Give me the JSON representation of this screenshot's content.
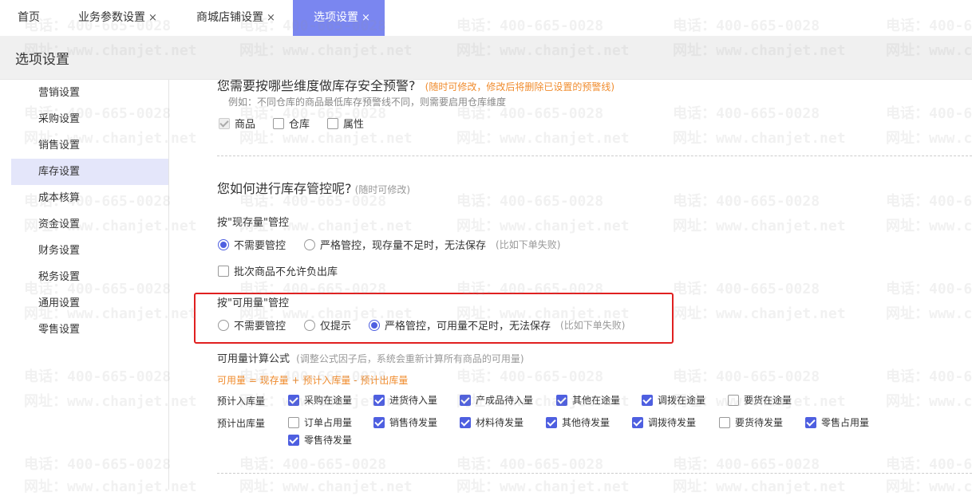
{
  "tabs": [
    {
      "label": "首页",
      "closable": false
    },
    {
      "label": "业务参数设置",
      "close": "×"
    },
    {
      "label": "商城店铺设置",
      "close": "×"
    },
    {
      "label": "选项设置",
      "close": "×",
      "active": true
    }
  ],
  "page_title": "选项设置",
  "sidebar": {
    "items": [
      "营销设置",
      "采购设置",
      "销售设置",
      "库存设置",
      "成本核算",
      "资金设置",
      "财务设置",
      "税务设置",
      "通用设置",
      "零售设置"
    ],
    "active_index": 3
  },
  "section1": {
    "question": "您需要按哪些维度做库存安全预警?",
    "hint": "(随时可修改，修改后将删除已设置的预警线)",
    "example": "例如：不同仓库的商品最低库存预警线不同，则需要启用仓库维度",
    "options": [
      {
        "label": "商品",
        "checked": true,
        "disabled": true
      },
      {
        "label": "仓库",
        "checked": false
      },
      {
        "label": "属性",
        "checked": false
      }
    ]
  },
  "section2": {
    "title": "您如何进行库存管控呢?",
    "title_note": "(随时可修改)",
    "stock": {
      "label": "按\"现存量\"管控",
      "options": [
        {
          "label": "不需要管控",
          "selected": true
        },
        {
          "label": "严格管控，现存量不足时，无法保存",
          "selected": false
        }
      ],
      "note": "(比如下单失败)",
      "batch_label": "批次商品不允许负出库"
    },
    "available": {
      "label": "按\"可用量\"管控",
      "options": [
        {
          "label": "不需要管控",
          "selected": false
        },
        {
          "label": "仅提示",
          "selected": false
        },
        {
          "label": "严格管控，可用量不足时，无法保存",
          "selected": true
        }
      ],
      "note": "(比如下单失败)"
    },
    "formula": {
      "label": "可用量计算公式",
      "note": "(调整公式因子后，系统会重新计算所有商品的可用量)",
      "expression": "可用量 = 现存量 + 预计入库量 - 预计出库量",
      "inbound_label": "预计入库量",
      "inbound": [
        {
          "label": "采购在途量",
          "checked": true
        },
        {
          "label": "进货待入量",
          "checked": true
        },
        {
          "label": "产成品待入量",
          "checked": true
        },
        {
          "label": "其他在途量",
          "checked": true
        },
        {
          "label": "调拨在途量",
          "checked": true
        },
        {
          "label": "要货在途量",
          "checked": false
        }
      ],
      "outbound_label": "预计出库量",
      "outbound": [
        {
          "label": "订单占用量",
          "checked": false
        },
        {
          "label": "销售待发量",
          "checked": true
        },
        {
          "label": "材料待发量",
          "checked": true
        },
        {
          "label": "其他待发量",
          "checked": true
        },
        {
          "label": "调拨待发量",
          "checked": true
        },
        {
          "label": "要货待发量",
          "checked": false
        },
        {
          "label": "零售占用量",
          "checked": true
        },
        {
          "label": "零售待发量",
          "checked": true
        }
      ]
    }
  },
  "watermark": {
    "phone": "电话：400-665-0028",
    "site": "网址：www.chanjet.net"
  },
  "colors": {
    "accent": "#4e5fe0",
    "active_tab": "#7a86f0",
    "highlight_border": "#e02020",
    "hint_orange": "#f08c2e"
  }
}
